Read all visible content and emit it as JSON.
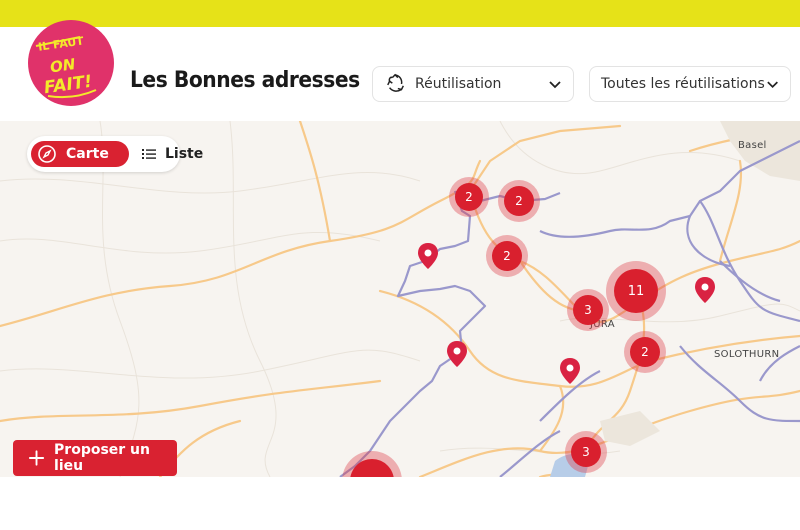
{
  "header": {
    "logo_text_top": "IL FAUT",
    "logo_text_main": "ON FAIT!",
    "title": "Les Bonnes adresses",
    "category_select": {
      "value": "Réutilisation",
      "icon": "recycle-icon"
    },
    "subcategory_select": {
      "value": "Toutes les réutilisations"
    }
  },
  "view_toggle": {
    "map_label": "Carte",
    "list_label": "Liste",
    "active": "map"
  },
  "propose_button": {
    "label": "Proposer un lieu"
  },
  "map": {
    "place_labels": [
      "Basel",
      "JURA",
      "SOLOTHURN"
    ],
    "clusters": [
      {
        "count": "2"
      },
      {
        "count": "2"
      },
      {
        "count": "2"
      },
      {
        "count": "11"
      },
      {
        "count": "3"
      },
      {
        "count": "2"
      },
      {
        "count": "3"
      },
      {
        "count": ""
      }
    ],
    "pins": 4,
    "colors": {
      "accent": "#d92231",
      "topbar": "#e6e218",
      "logo": "#e0326a",
      "border_line": "#9a98cc",
      "road": "#f7c98a"
    }
  }
}
